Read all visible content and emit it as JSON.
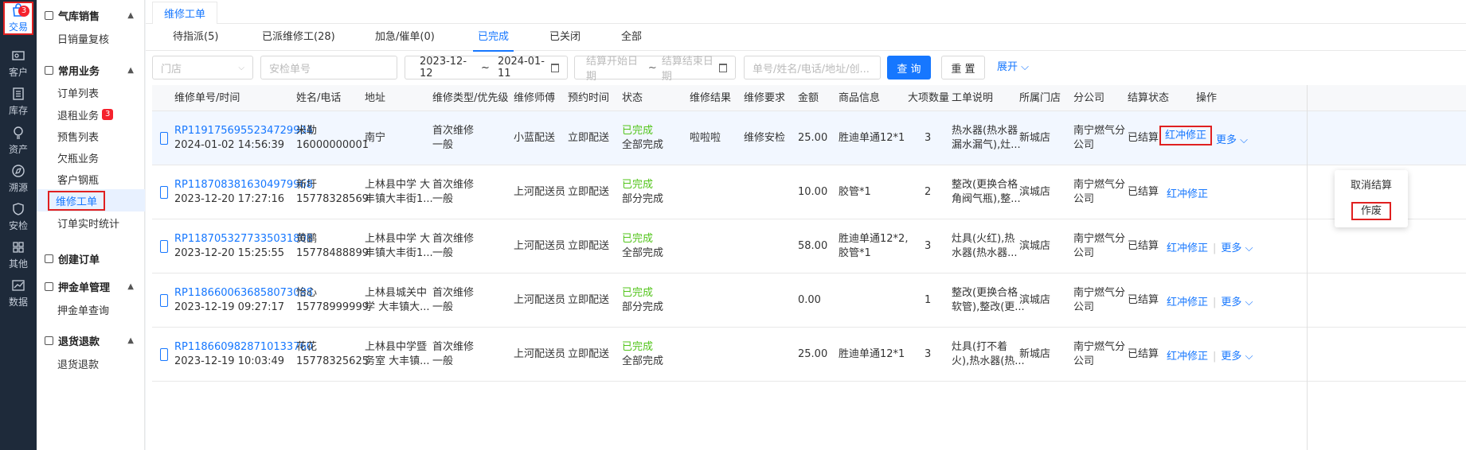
{
  "rail": [
    {
      "label": "交易",
      "icon": "bag-icon",
      "badge": "3"
    },
    {
      "label": "客户",
      "icon": "id-card-icon"
    },
    {
      "label": "库存",
      "icon": "inventory-icon"
    },
    {
      "label": "资产",
      "icon": "bulb-icon"
    },
    {
      "label": "溯源",
      "icon": "compass-icon"
    },
    {
      "label": "安检",
      "icon": "shield-icon"
    },
    {
      "label": "其他",
      "icon": "grid-icon"
    },
    {
      "label": "数据",
      "icon": "chart-icon"
    }
  ],
  "menu": {
    "g1": "气库销售",
    "g1_items": [
      "日销量复核"
    ],
    "g2": "常用业务",
    "g2_items": [
      "订单列表",
      "退租业务",
      "预售列表",
      "欠瓶业务",
      "客户钢瓶",
      "维修工单",
      "订单实时统计"
    ],
    "g2_badge": "3",
    "g3": "创建订单",
    "g4": "押金单管理",
    "g4_items": [
      "押金单查询"
    ],
    "g5": "退货退款",
    "g5_items": [
      "退货退款"
    ]
  },
  "page_tab": "维修工单",
  "status_tabs": [
    "待指派(5)",
    "已派维修工(28)",
    "加急/催单(0)",
    "已完成",
    "已关闭",
    "全部"
  ],
  "filters": {
    "store_placeholder": "门店",
    "inspect_placeholder": "安检单号",
    "date_start": "2023-12-12",
    "date_sep": "~",
    "date_end": "2024-01-11",
    "settle_start_placeholder": "结算开始日期",
    "settle_end_placeholder": "结算结束日期",
    "keyword_placeholder": "单号/姓名/电话/地址/创...",
    "query": "查 询",
    "reset": "重 置",
    "expand": "展开"
  },
  "columns": [
    "维修单号/时间",
    "姓名/电话",
    "地址",
    "维修类型/优先级",
    "维修师傅",
    "预约时间",
    "状态",
    "维修结果",
    "维修要求",
    "金额",
    "商品信息",
    "大项数量",
    "工单说明",
    "所属门店",
    "分公司",
    "结算状态",
    "操作"
  ],
  "rows": [
    {
      "no": "RP1191756955234729984",
      "time": "2024-01-02 14:56:39",
      "name": "米勒",
      "phone": "16000000001",
      "addr1": "南宁",
      "addr2": "",
      "type": "首次维修",
      "prio": "一般",
      "worker": "小蓝配送",
      "appt": "立即配送",
      "status": "已完成",
      "sub": "全部完成",
      "result": "啦啦啦",
      "req": "维修安检",
      "amount": "25.00",
      "goods1": "胜迪单通12*1",
      "goods2": "",
      "qty": "3",
      "desc1": "热水器(热水器",
      "desc2": "漏水漏气),灶...",
      "store": "新城店",
      "co1": "南宁燃气分",
      "co2": "公司",
      "settle": "已结算"
    },
    {
      "no": "RP1187083816304979968",
      "time": "2023-12-20 17:27:16",
      "name": "新圩",
      "phone": "15778328569",
      "addr1": "上林县中学 大",
      "addr2": "丰镇大丰街1...",
      "type": "首次维修",
      "prio": "一般",
      "worker": "上河配送员",
      "appt": "立即配送",
      "status": "已完成",
      "sub": "部分完成",
      "result": "",
      "req": "",
      "amount": "10.00",
      "goods1": "胶管*1",
      "goods2": "",
      "qty": "2",
      "desc1": "整改(更换合格",
      "desc2": "角阀气瓶),整...",
      "store": "滨城店",
      "co1": "南宁燃气分",
      "co2": "公司",
      "settle": "已结算"
    },
    {
      "no": "RP1187053277335031808",
      "time": "2023-12-20 15:25:55",
      "name": "黄鹂",
      "phone": "15778488899",
      "addr1": "上林县中学 大",
      "addr2": "丰镇大丰街1...",
      "type": "首次维修",
      "prio": "一般",
      "worker": "上河配送员",
      "appt": "立即配送",
      "status": "已完成",
      "sub": "全部完成",
      "result": "",
      "req": "",
      "amount": "58.00",
      "goods1": "胜迪单通12*2,",
      "goods2": "胶管*1",
      "qty": "3",
      "desc1": "灶具(火红),热",
      "desc2": "水器(热水器...",
      "store": "滨城店",
      "co1": "南宁燃气分",
      "co2": "公司",
      "settle": "已结算"
    },
    {
      "no": "RP1186600636858073088",
      "time": "2023-12-19 09:27:17",
      "name": "怡心",
      "phone": "15778999999",
      "addr1": "上林县城关中",
      "addr2": "学 大丰镇大...",
      "type": "首次维修",
      "prio": "一般",
      "worker": "上河配送员",
      "appt": "立即配送",
      "status": "已完成",
      "sub": "部分完成",
      "result": "",
      "req": "",
      "amount": "0.00",
      "goods1": "",
      "goods2": "",
      "qty": "1",
      "desc1": "整改(更换合格",
      "desc2": "软管),整改(更...",
      "store": "滨城店",
      "co1": "南宁燃气分",
      "co2": "公司",
      "settle": "已结算"
    },
    {
      "no": "RP1186609828710133760",
      "time": "2023-12-19 10:03:49",
      "name": "花花",
      "phone": "15778325625",
      "addr1": "上林县中学暨",
      "addr2": "务室 大丰镇...",
      "type": "首次维修",
      "prio": "一般",
      "worker": "上河配送员",
      "appt": "立即配送",
      "status": "已完成",
      "sub": "全部完成",
      "result": "",
      "req": "",
      "amount": "25.00",
      "goods1": "胜迪单通12*1",
      "goods2": "",
      "qty": "3",
      "desc1": "灶具(打不着",
      "desc2": "火),热水器(热...",
      "store": "新城店",
      "co1": "南宁燃气分",
      "co2": "公司",
      "settle": "已结算"
    }
  ],
  "ops": {
    "fix": "红冲修正",
    "more": "更多"
  },
  "dropdown": [
    "取消结算",
    "作废"
  ],
  "colors": {
    "accent": "#1677ff",
    "success": "#52c41a",
    "highlight": "#e02020",
    "rail": "#1e2a3a"
  }
}
